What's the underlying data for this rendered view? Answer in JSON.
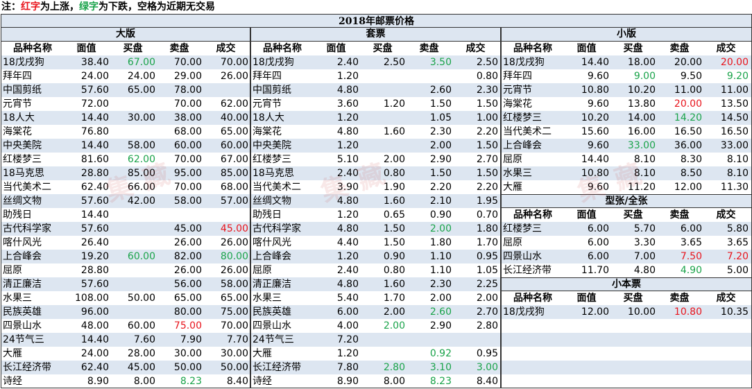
{
  "note": {
    "prefix": "注：",
    "red_word": "红字",
    "mid1": "为上涨，",
    "green_word": "绿字",
    "mid2": "为下跌，空格为近期无交易"
  },
  "title": "2018年邮票价格",
  "colors": {
    "up": "#e8141c",
    "down": "#1aa34a",
    "band": "#dde6f1"
  },
  "headers": {
    "full": [
      "品种名称",
      "面值",
      "买盘",
      "卖盘",
      "成交"
    ]
  },
  "sections": {
    "daban": {
      "title": "大版",
      "rows": [
        {
          "n": "18戊戌狗",
          "v": "38.40",
          "b": "67.00",
          "s": "70.00",
          "d": "70.00",
          "bc": "g"
        },
        {
          "n": "拜年四",
          "v": "24.00",
          "b": "24.00",
          "s": "29.00",
          "d": "26.00"
        },
        {
          "n": "中国剪纸",
          "v": "57.60",
          "b": "65.00",
          "s": "78.00",
          "d": ""
        },
        {
          "n": "元宵节",
          "v": "72.00",
          "b": "",
          "s": "70.00",
          "d": "62.00"
        },
        {
          "n": "18人大",
          "v": "14.40",
          "b": "30.00",
          "s": "38.00",
          "d": "40.00"
        },
        {
          "n": "海棠花",
          "v": "76.80",
          "b": "",
          "s": "68.00",
          "d": "65.00"
        },
        {
          "n": "中央美院",
          "v": "14.40",
          "b": "58.00",
          "s": "60.00",
          "d": "60.00"
        },
        {
          "n": "红楼梦三",
          "v": "81.60",
          "b": "62.00",
          "s": "70.00",
          "d": "67.00",
          "bc": "g"
        },
        {
          "n": "18马克思",
          "v": "28.80",
          "b": "85.00",
          "s": "95.00",
          "d": "85.00"
        },
        {
          "n": "当代美术二",
          "v": "62.40",
          "b": "66.00",
          "s": "70.00",
          "d": "68.00"
        },
        {
          "n": "丝绸文物",
          "v": "57.60",
          "b": "42.00",
          "s": "58.00",
          "d": "57.00"
        },
        {
          "n": "助残日",
          "v": "14.40",
          "b": "",
          "s": "",
          "d": ""
        },
        {
          "n": "古代科学家",
          "v": "57.60",
          "b": "",
          "s": "45.00",
          "d": "45.00",
          "dc": "r"
        },
        {
          "n": "喀什风光",
          "v": "26.40",
          "b": "",
          "s": "26.00",
          "d": "26.00"
        },
        {
          "n": "上合峰会",
          "v": "19.20",
          "b": "60.00",
          "s": "82.00",
          "d": "80.00",
          "bc": "g",
          "dc": "g"
        },
        {
          "n": "屈原",
          "v": "28.80",
          "b": "",
          "s": "26.00",
          "d": "26.00"
        },
        {
          "n": "清正廉洁",
          "v": "57.60",
          "b": "",
          "s": "56.00",
          "d": "58.00"
        },
        {
          "n": "水果三",
          "v": "108.00",
          "b": "50.00",
          "s": "65.00",
          "d": "65.00"
        },
        {
          "n": "民族英雄",
          "v": "96.00",
          "b": "",
          "s": "80.00",
          "d": "75.00"
        },
        {
          "n": "四景山水",
          "v": "48.00",
          "b": "60.00",
          "s": "75.00",
          "d": "70.00",
          "sc": "r"
        },
        {
          "n": "24节气三",
          "v": "14.40",
          "b": "7.60",
          "s": "7.90",
          "d": "7.70"
        },
        {
          "n": "大雁",
          "v": "24.00",
          "b": "28.00",
          "s": "30.00",
          "d": "30.00"
        },
        {
          "n": "长江经济带",
          "v": "62.40",
          "b": "45.00",
          "s": "50.00",
          "d": "50.00"
        },
        {
          "n": "诗经",
          "v": "8.90",
          "b": "8.00",
          "s": "8.23",
          "d": "8.40",
          "sc": "g"
        }
      ]
    },
    "taopiao": {
      "title": "套票",
      "rows": [
        {
          "n": "18戊戌狗",
          "v": "2.40",
          "b": "2.50",
          "s": "3.50",
          "d": "2.50",
          "sc": "g"
        },
        {
          "n": "拜年四",
          "v": "1.20",
          "b": "",
          "s": "",
          "d": "0.80"
        },
        {
          "n": "中国剪纸",
          "v": "4.80",
          "b": "",
          "s": "2.60",
          "d": "2.30"
        },
        {
          "n": "元宵节",
          "v": "3.60",
          "b": "1.20",
          "s": "1.50",
          "d": "1.50"
        },
        {
          "n": "18人大",
          "v": "1.20",
          "b": "",
          "s": "1.05",
          "d": "1.00"
        },
        {
          "n": "海棠花",
          "v": "4.80",
          "b": "1.60",
          "s": "2.30",
          "d": "2.20"
        },
        {
          "n": "中央美院",
          "v": "1.20",
          "b": "",
          "s": "2.00",
          "d": "1.50"
        },
        {
          "n": "红楼梦三",
          "v": "5.10",
          "b": "2.00",
          "s": "2.90",
          "d": "2.70"
        },
        {
          "n": "18马克思",
          "v": "2.40",
          "b": "0.80",
          "s": "1.50",
          "d": "1.50"
        },
        {
          "n": "当代美术二",
          "v": "3.90",
          "b": "1.90",
          "s": "2.20",
          "d": "2.20"
        },
        {
          "n": "丝绸文物",
          "v": "4.80",
          "b": "1.60",
          "s": "2.10",
          "d": "1.95"
        },
        {
          "n": "助残日",
          "v": "1.20",
          "b": "0.65",
          "s": "0.90",
          "d": "0.70"
        },
        {
          "n": "古代科学家",
          "v": "4.80",
          "b": "1.50",
          "s": "2.00",
          "d": "1.80",
          "sc": "g"
        },
        {
          "n": "喀什风光",
          "v": "4.40",
          "b": "1.50",
          "s": "1.80",
          "d": "1.70"
        },
        {
          "n": "上合峰会",
          "v": "1.20",
          "b": "0.90",
          "s": "1.10",
          "d": "0.95"
        },
        {
          "n": "屈原",
          "v": "2.40",
          "b": "0.80",
          "s": "1.10",
          "d": "1.05"
        },
        {
          "n": "清正廉洁",
          "v": "4.80",
          "b": "1.60",
          "s": "2.30",
          "d": "2.25"
        },
        {
          "n": "水果三",
          "v": "5.40",
          "b": "1.70",
          "s": "2.00",
          "d": "2.00"
        },
        {
          "n": "民族英雄",
          "v": "6.00",
          "b": "2.00",
          "s": "2.60",
          "d": "2.70",
          "sc": "g"
        },
        {
          "n": "四景山水",
          "v": "4.00",
          "b": "2.00",
          "s": "2.90",
          "d": "2.80",
          "bc": "g"
        },
        {
          "n": "24节气三",
          "v": "7.20",
          "b": "",
          "s": "",
          "d": ""
        },
        {
          "n": "大雁",
          "v": "1.20",
          "b": "",
          "s": "0.92",
          "d": "0.95",
          "sc": "g"
        },
        {
          "n": "长江经济带",
          "v": "7.80",
          "b": "2.80",
          "s": "3.10",
          "d": "3.00",
          "bc": "g",
          "sc": "g",
          "dc": "g"
        },
        {
          "n": "诗经",
          "v": "8.90",
          "b": "8.00",
          "s": "8.23",
          "d": "8.40",
          "sc": "g"
        }
      ]
    },
    "xiaoban": {
      "title": "小版",
      "rows": [
        {
          "n": "18戊戌狗",
          "v": "14.40",
          "b": "18.00",
          "s": "20.00",
          "d": "20.00",
          "dc": "r"
        },
        {
          "n": "拜年四",
          "v": "9.60",
          "b": "9.00",
          "s": "9.50",
          "d": "9.20",
          "bc": "g",
          "dc": "g"
        },
        {
          "n": "元宵节",
          "v": "10.80",
          "b": "10.20",
          "s": "11.00",
          "d": "11.00"
        },
        {
          "n": "海棠花",
          "v": "9.60",
          "b": "13.80",
          "s": "20.00",
          "d": "13.50",
          "sc": "r"
        },
        {
          "n": "红楼梦三",
          "v": "10.20",
          "b": "14.00",
          "s": "14.20",
          "d": "14.50",
          "sc": "g"
        },
        {
          "n": "当代美术二",
          "v": "15.60",
          "b": "16.00",
          "s": "16.50",
          "d": "16.50"
        },
        {
          "n": "上合峰会",
          "v": "9.60",
          "b": "33.00",
          "s": "36.00",
          "d": "33.00",
          "bc": "g"
        },
        {
          "n": "屈原",
          "v": "14.40",
          "b": "8.10",
          "s": "8.30",
          "d": "8.10"
        },
        {
          "n": "水果三",
          "v": "10.80",
          "b": "8.10",
          "s": "8.50",
          "d": "8.10"
        },
        {
          "n": "大雁",
          "v": "9.60",
          "b": "11.20",
          "s": "12.00",
          "d": "11.30"
        }
      ]
    },
    "xingzhang": {
      "title": "型张/全张",
      "rows": [
        {
          "n": "红楼梦三",
          "v": "6.00",
          "b": "5.70",
          "s": "6.00",
          "d": "5.80"
        },
        {
          "n": "屈原",
          "v": "6.00",
          "b": "3.30",
          "s": "3.65",
          "d": "3.65"
        },
        {
          "n": "四景山水",
          "v": "6.00",
          "b": "7.00",
          "s": "7.50",
          "d": "7.20",
          "sc": "r",
          "dc": "r"
        },
        {
          "n": "长江经济带",
          "v": "11.70",
          "b": "4.80",
          "s": "4.90",
          "d": "5.00",
          "sc": "g"
        }
      ]
    },
    "xiaobenpiao": {
      "title": "小本票",
      "rows": [
        {
          "n": "18戊戌狗",
          "v": "12.00",
          "b": "10.00",
          "s": "10.80",
          "d": "10.35",
          "sc": "r"
        }
      ]
    }
  },
  "watermark": "集藏"
}
